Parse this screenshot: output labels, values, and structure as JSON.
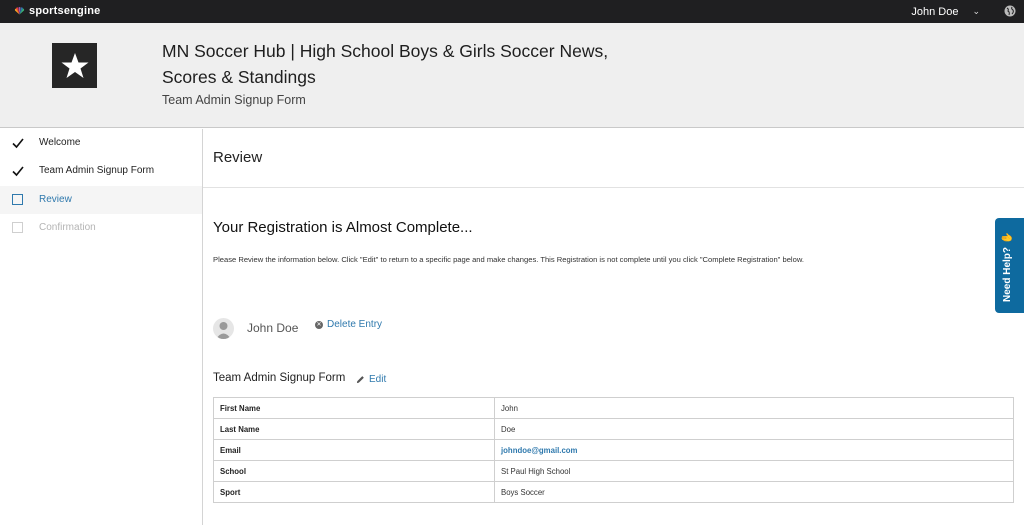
{
  "topbar": {
    "brand_label": "sportsengine",
    "user_name": "John Doe",
    "icons": {
      "dropdown": "chevron-down-icon",
      "globe": "globe-icon"
    }
  },
  "header": {
    "site_title": "MN Soccer Hub | High School Boys & Girls Soccer News, Scores & Standings",
    "form_subtitle": "Team Admin Signup Form"
  },
  "steps": [
    {
      "label": "Welcome",
      "state": "complete"
    },
    {
      "label": "Team Admin Signup Form",
      "state": "complete"
    },
    {
      "label": "Review",
      "state": "current"
    },
    {
      "label": "Confirmation",
      "state": "upcoming"
    }
  ],
  "main": {
    "page_title": "Review",
    "heading": "Your Registration is Almost Complete...",
    "instructions": "Please Review the information below. Click \"Edit\" to return to a specific page and make changes. This Registration is not complete until you click \"Complete Registration\" below.",
    "entry": {
      "name": "John Doe",
      "delete_label": "Delete Entry"
    },
    "form_section": {
      "title": "Team Admin Signup Form",
      "edit_label": "Edit",
      "rows": [
        {
          "label": "First Name",
          "value": "John"
        },
        {
          "label": "Last Name",
          "value": "Doe"
        },
        {
          "label": "Email",
          "value": "johndoe@gmail.com"
        },
        {
          "label": "School",
          "value": "St Paul High School"
        },
        {
          "label": "Sport",
          "value": "Boys Soccer"
        }
      ]
    }
  },
  "help_tab": {
    "label": "Need Help?",
    "icon": "hand-wave-icon"
  },
  "colors": {
    "link": "#2f79ad",
    "topbar": "#1f1f21",
    "help_tab": "#0e6a9f"
  }
}
